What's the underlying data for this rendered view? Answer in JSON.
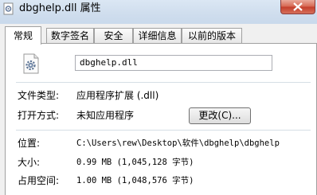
{
  "window": {
    "title": "dbghelp.dll 属性"
  },
  "tabs": [
    {
      "label": "常规",
      "active": true
    },
    {
      "label": "数字签名",
      "active": false
    },
    {
      "label": "安全",
      "active": false
    },
    {
      "label": "详细信息",
      "active": false
    },
    {
      "label": "以前的版本",
      "active": false
    }
  ],
  "general": {
    "file_name": "dbghelp.dll",
    "file_type_label": "文件类型:",
    "file_type_value": "应用程序扩展 (.dll)",
    "opens_with_label": "打开方式:",
    "opens_with_value": "未知应用程序",
    "change_button": "更改(C)...",
    "location_label": "位置:",
    "location_value": "C:\\Users\\rew\\Desktop\\软件\\dbghelp\\dbghelp",
    "size_label": "大小:",
    "size_value": "0.99 MB (1,045,128 字节)",
    "disk_size_label": "占用空间:",
    "disk_size_value": "1.00 MB (1,048,576 字节)"
  },
  "colors": {
    "titlebar": "#cfdded",
    "close_button": "#c33d2a",
    "panel_background": "#ffffff",
    "window_background": "#f0f0f0"
  }
}
